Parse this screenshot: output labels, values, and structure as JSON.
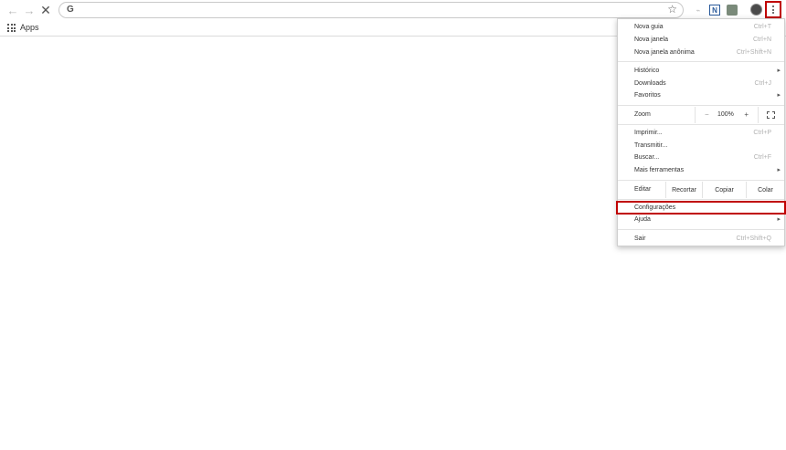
{
  "toolbar": {
    "back_icon": "arrow-left-icon",
    "forward_icon": "arrow-right-icon",
    "stop_icon": "close-icon",
    "omnibox_glyph": "G",
    "bookmark_icon": "star-icon",
    "extension_2_glyph": "N",
    "menu_icon": "three-dots-vertical-icon"
  },
  "bookmarks": {
    "apps_label": "Apps"
  },
  "menu": {
    "items": [
      {
        "label": "Nova guia",
        "shortcut": "Ctrl+T"
      },
      {
        "label": "Nova janela",
        "shortcut": "Ctrl+N"
      },
      {
        "label": "Nova janela anônima",
        "shortcut": "Ctrl+Shift+N"
      },
      {
        "label": "Histórico",
        "submenu": true
      },
      {
        "label": "Downloads",
        "shortcut": "Ctrl+J"
      },
      {
        "label": "Favoritos",
        "submenu": true
      },
      {
        "label": "Imprimir...",
        "shortcut": "Ctrl+P"
      },
      {
        "label": "Transmitir..."
      },
      {
        "label": "Buscar...",
        "shortcut": "Ctrl+F"
      },
      {
        "label": "Mais ferramentas",
        "submenu": true
      },
      {
        "label": "Configurações"
      },
      {
        "label": "Ajuda",
        "submenu": true
      },
      {
        "label": "Sair",
        "shortcut": "Ctrl+Shift+Q"
      }
    ],
    "zoom": {
      "label": "Zoom",
      "minus": "−",
      "value": "100%",
      "plus": "+"
    },
    "edit": {
      "label": "Editar",
      "cut": "Recortar",
      "copy": "Copiar",
      "paste": "Colar"
    },
    "submenu_arrow": "▸"
  },
  "colors": {
    "highlight": "#c00000"
  }
}
